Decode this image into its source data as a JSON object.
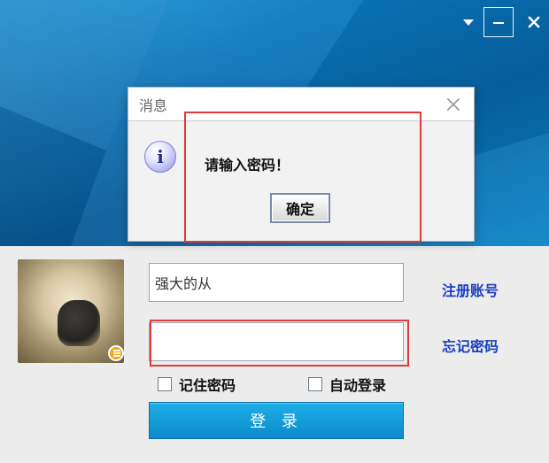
{
  "window": {
    "controls": {
      "dropdown_icon": "chevron-down-icon",
      "minimize_icon": "minus-icon",
      "close_icon": "close-icon"
    }
  },
  "dialog": {
    "title": "消息",
    "message": "请输入密码！",
    "ok_label": "确定",
    "info_icon_text": "i"
  },
  "login": {
    "username_value": "强大的从",
    "password_value": "",
    "register_label": "注册账号",
    "forgot_label": "忘记密码",
    "remember_label": "记住密码",
    "auto_login_label": "自动登录",
    "login_button_label": "登 录"
  },
  "colors": {
    "banner_blue": "#0a74b9",
    "link_blue": "#1b3fbf",
    "button_blue": "#0c8bcc",
    "highlight_red": "#e03a3a"
  }
}
